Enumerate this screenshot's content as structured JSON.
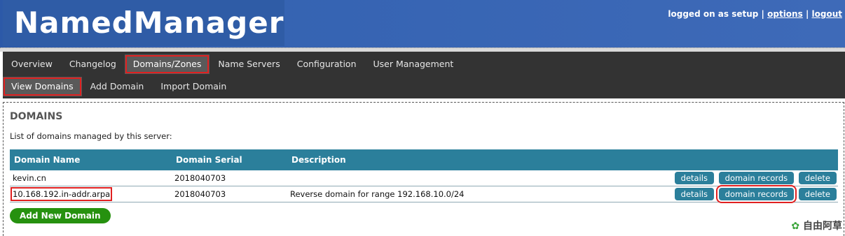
{
  "app": {
    "title": "NamedManager"
  },
  "userbar": {
    "prefix": "logged on as setup |",
    "options": "options",
    "sep": "|",
    "logout": "logout"
  },
  "nav": {
    "main": [
      "Overview",
      "Changelog",
      "Domains/Zones",
      "Name Servers",
      "Configuration",
      "User Management"
    ],
    "sub": [
      "View Domains",
      "Add Domain",
      "Import Domain"
    ]
  },
  "page": {
    "title": "DOMAINS",
    "subtitle": "List of domains managed by this server:"
  },
  "table": {
    "headers": [
      "Domain Name",
      "Domain Serial",
      "Description"
    ],
    "rows": [
      {
        "name": "kevin.cn",
        "serial": "2018040703",
        "description": ""
      },
      {
        "name": "10.168.192.in-addr.arpa",
        "serial": "2018040703",
        "description": "Reverse domain for range 192.168.10.0/24"
      }
    ],
    "actions": {
      "details": "details",
      "records": "domain records",
      "delete": "delete"
    }
  },
  "add_button": "Add New Domain",
  "watermark": "自由阿草"
}
